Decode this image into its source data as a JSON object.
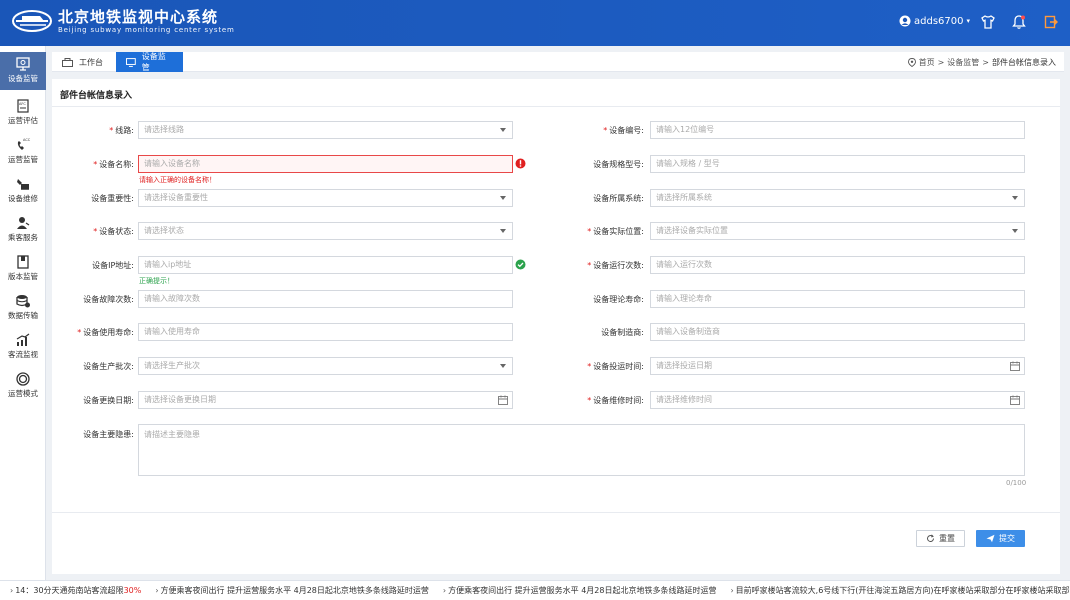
{
  "header": {
    "title": "北京地铁监视中心系统",
    "subtitle": "Beijing subway monitoring center system",
    "username": "adds6700",
    "brand_color": "#1a56b8"
  },
  "sidebar": {
    "items": [
      {
        "label": "设备监管",
        "icon": "monitor-icon",
        "active": true
      },
      {
        "label": "运营评估",
        "icon": "afc-icon"
      },
      {
        "label": "运营监管",
        "icon": "acc-phone-icon"
      },
      {
        "label": "设备维修",
        "icon": "repair-icon"
      },
      {
        "label": "乘客服务",
        "icon": "passenger-icon"
      },
      {
        "label": "版本监管",
        "icon": "version-icon"
      },
      {
        "label": "数据传输",
        "icon": "database-icon"
      },
      {
        "label": "客流监视",
        "icon": "chart-icon"
      },
      {
        "label": "运营模式",
        "icon": "mode-icon"
      }
    ]
  },
  "tabs": [
    {
      "label": "工作台",
      "icon": "workbench-icon"
    },
    {
      "label": "设备监管",
      "icon": "monitor-icon",
      "active": true
    }
  ],
  "breadcrumb": {
    "items": [
      "首页",
      "设备监管",
      "部件台帐信息录入"
    ],
    "separator": ">"
  },
  "form": {
    "title": "部件台帐信息录入",
    "fields": {
      "line": {
        "label": "线路:",
        "placeholder": "请选择线路",
        "required": true
      },
      "code": {
        "label": "设备编号:",
        "placeholder": "请输入12位编号",
        "required": true
      },
      "name": {
        "label": "设备名称:",
        "placeholder": "请输入设备名称",
        "required": true,
        "error": "请输入正确的设备名称！"
      },
      "spec": {
        "label": "设备规格型号:",
        "placeholder": "请输入规格 / 型号"
      },
      "importance": {
        "label": "设备重要性:",
        "placeholder": "请选择设备重要性"
      },
      "system": {
        "label": "设备所属系统:",
        "placeholder": "请选择所属系统"
      },
      "status": {
        "label": "设备状态:",
        "placeholder": "请选择状态",
        "required": true
      },
      "location": {
        "label": "设备实际位置:",
        "placeholder": "请选择设备实际位置",
        "required": true
      },
      "ip": {
        "label": "设备IP地址:",
        "placeholder": "请输入ip地址",
        "ok": "正确提示！"
      },
      "runs": {
        "label": "设备运行次数:",
        "placeholder": "请输入运行次数",
        "required": true
      },
      "faults": {
        "label": "设备故障次数:",
        "placeholder": "请输入故障次数"
      },
      "theory_life": {
        "label": "设备理论寿命:",
        "placeholder": "请输入理论寿命"
      },
      "use_life": {
        "label": "设备使用寿命:",
        "placeholder": "请输入使用寿命",
        "required": true
      },
      "maker": {
        "label": "设备制造商:",
        "placeholder": "请输入设备制造商"
      },
      "batch": {
        "label": "设备生产批次:",
        "placeholder": "请选择生产批次"
      },
      "op_time": {
        "label": "设备投运时间:",
        "placeholder": "请选择投运日期",
        "required": true
      },
      "replace_date": {
        "label": "设备更换日期:",
        "placeholder": "请选择设备更换日期"
      },
      "repair_time": {
        "label": "设备维修时间:",
        "placeholder": "请选择维修时间",
        "required": true
      },
      "hazard": {
        "label": "设备主要隐患:",
        "placeholder": "请描述主要隐患",
        "counter": "0/100"
      }
    },
    "required_mark": "*",
    "reset_label": "重置",
    "submit_label": "提交"
  },
  "ticker": {
    "items": [
      {
        "pre": "14：30分天通苑南站客流超限",
        "highlight": "30%"
      },
      {
        "pre": "方便乘客夜间出行 提升运营服务水平 4月28日起北京地铁多条线路延时运营"
      },
      {
        "pre": "方便乘客夜间出行 提升运营服务水平 4月28日起北京地铁多条线路延时运营"
      },
      {
        "pre": "目前呼家楼站客流较大,6号线下行(开往海淀五路居方向)在呼家楼站采取部分在呼家楼站采取部分"
      }
    ]
  }
}
